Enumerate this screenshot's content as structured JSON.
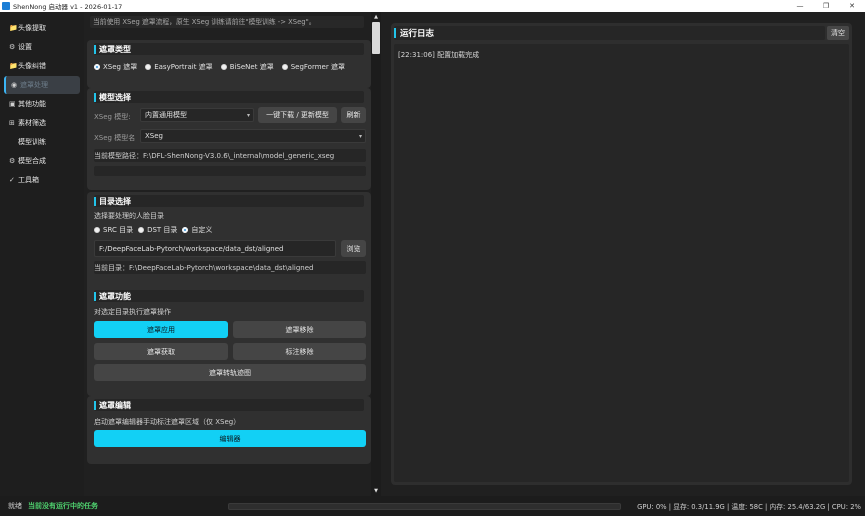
{
  "window": {
    "title": "ShenNong 启动器 v1 - 2026-01-17",
    "minimize": "—",
    "maximize": "❐",
    "close": "✕"
  },
  "sidebar": {
    "items": [
      {
        "icon": "📁",
        "label": "头像提取"
      },
      {
        "icon": "⚙",
        "label": "设置"
      },
      {
        "icon": "📁",
        "label": "头像纠错"
      },
      {
        "icon": "◉",
        "label": "遮罩处理"
      },
      {
        "icon": "▣",
        "label": "其他功能"
      },
      {
        "icon": "⊞",
        "label": "素材筛选"
      },
      {
        "icon": "",
        "label": "模型训练"
      },
      {
        "icon": "⚙",
        "label": "模型合成"
      },
      {
        "icon": "✓",
        "label": "工具箱"
      }
    ]
  },
  "main": {
    "hint": "当前使用 XSeg 遮罩流程，原生 XSeg 训练请前往\"模型训练 -> XSeg\"。",
    "mask_type": {
      "title": "遮罩类型",
      "options": [
        "XSeg 遮罩",
        "EasyPortrait 遮罩",
        "BiSeNet 遮罩",
        "SegFormer 遮罩"
      ],
      "selected": "XSeg 遮罩"
    },
    "model_select": {
      "title": "模型选择",
      "model_label": "XSeg 模型:",
      "model_value": "内置通用模型",
      "download_button": "一键下载 / 更新模型",
      "refresh_button": "刷新",
      "name_label": "XSeg 模型名",
      "name_value": "XSeg",
      "path_text": "当前模型路径：F:\\DFL-ShenNong-V3.0.6\\_internal\\model_generic_xseg"
    },
    "dir_select": {
      "title": "目录选择",
      "prompt": "选择要处理的人脸目录",
      "options": [
        "SRC 目录",
        "DST 目录",
        "自定义"
      ],
      "selected": "自定义",
      "path_value": "F:/DeepFaceLab-Pytorch/workspace/data_dst/aligned",
      "browse_button": "浏览",
      "current_dir": "当前目录：F:\\DeepFaceLab-Pytorch\\workspace\\data_dst\\aligned"
    },
    "mask_func": {
      "title": "遮罩功能",
      "prompt": "对选定目录执行遮罩操作",
      "apply_button": "遮罩应用",
      "remove_button": "遮罩移除",
      "fetch_button": "遮罩获取",
      "label_remove_button": "标注移除",
      "convert_button": "遮罩转轨迹图"
    },
    "mask_edit": {
      "title": "遮罩编辑",
      "prompt": "启动遮罩编辑器手动标注遮罩区域（仅 XSeg）",
      "editor_button": "编辑器"
    }
  },
  "log": {
    "title": "运行日志",
    "clear_button": "清空",
    "lines": [
      "[22:31:06] 配置加载完成"
    ]
  },
  "status": {
    "ready": "就绪",
    "task": "当前没有运行中的任务",
    "stats": "GPU: 0% | 显存: 0.3/11.9G | 温度: 58C | 内存: 25.4/63.2G | CPU: 2%"
  },
  "colors": {
    "accent": "#12d0f5",
    "success": "#4fd36f",
    "background": "#202020"
  }
}
